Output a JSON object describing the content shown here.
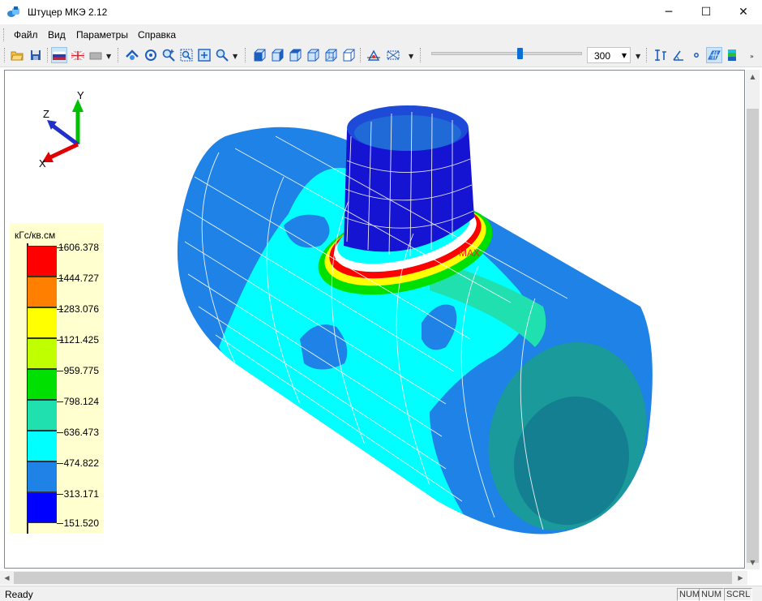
{
  "window": {
    "title": "Штуцер МКЭ 2.12",
    "app_icon": "app-icon",
    "controls": {
      "minimize": "─",
      "maximize": "☐",
      "close": "✕"
    }
  },
  "menu": [
    {
      "name": "menu-file",
      "label": "Файл"
    },
    {
      "name": "menu-view",
      "label": "Вид"
    },
    {
      "name": "menu-params",
      "label": "Параметры"
    },
    {
      "name": "menu-help",
      "label": "Справка"
    }
  ],
  "toolbar": {
    "slider_level_percent": 59,
    "zoom_combo_value": "300",
    "buttons": [
      "open-folder-icon",
      "save-disk-icon",
      "flag-russia-icon",
      "flag-uk-icon",
      "print-icon",
      "pan-icon",
      "rotate-icon",
      "zoom-in-icon",
      "zoom-window-icon",
      "fit-icon",
      "zoom-pan-icon",
      "view-front-icon",
      "view-back-icon",
      "view-left-icon",
      "view-right-icon",
      "view-top-icon",
      "view-bottom-icon",
      "axes-view-icon",
      "perspective-icon",
      "dimension-icon",
      "angle-icon",
      "point-icon",
      "mesh-shaded-icon",
      "colormap-icon"
    ],
    "colors": {
      "accent": "#0d6fd6",
      "pressed": "#cce4f7"
    }
  },
  "legend": {
    "unit": "кГс/кв.см",
    "ticks": [
      "1606.378",
      "1444.727",
      "1283.076",
      "1121.425",
      "959.775",
      "798.124",
      "636.473",
      "474.822",
      "313.171",
      "151.520"
    ],
    "colors": [
      "#ff0000",
      "#ff8000",
      "#ffff00",
      "#c0ff00",
      "#00e000",
      "#20e0b0",
      "#00ffff",
      "#1e90ff",
      "#0000ff"
    ]
  },
  "viewport": {
    "axis_labels": {
      "y": "Y",
      "z": "Z",
      "x": "X"
    },
    "max_label": "MAX"
  },
  "status": {
    "text": "Ready",
    "panes": [
      "NUM",
      "NUM",
      "SCRL"
    ]
  }
}
